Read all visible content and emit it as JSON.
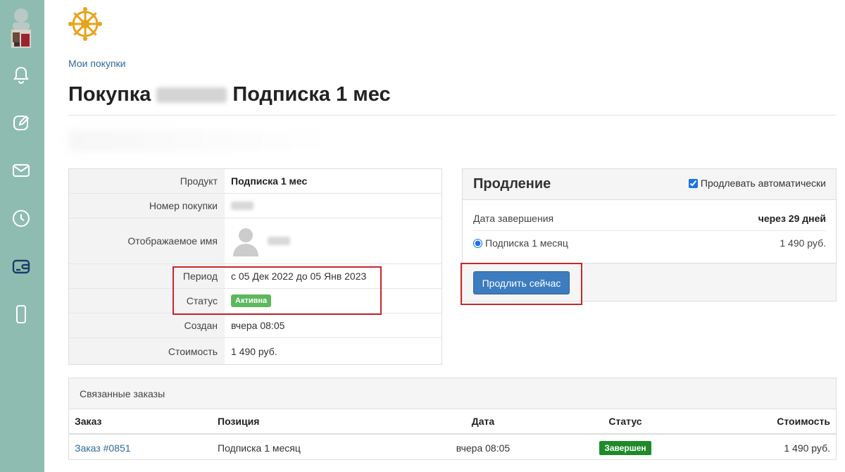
{
  "colors": {
    "sidebar": "#8fbcb1",
    "link": "#2f6a9a",
    "active_badge": "#5cb85c",
    "done_badge": "#1f8a2a",
    "primary_button": "#3c7cbf",
    "highlight": "#c8262d"
  },
  "sidebar": {
    "icons": [
      "user-avatar",
      "bell-icon",
      "edit-icon",
      "mail-icon",
      "clock-icon",
      "wallet-icon",
      "phone-icon"
    ]
  },
  "breadcrumb": "Мои покупки",
  "title": {
    "prefix": "Покупка",
    "suffix": "Подписка 1 мес"
  },
  "details": {
    "rows": [
      {
        "label": "Продукт",
        "value": "Подписка 1 мес"
      },
      {
        "label": "Номер покупки",
        "value": ""
      },
      {
        "label": "Отображаемое имя",
        "value": ""
      },
      {
        "label": "Период",
        "value": "с 05 Дек 2022 до 05 Янв 2023"
      },
      {
        "label": "Статус",
        "value": "Активна"
      },
      {
        "label": "Создан",
        "value": "вчера 08:05"
      },
      {
        "label": "Стоимость",
        "value": "1 490 руб."
      }
    ]
  },
  "renewal": {
    "title": "Продление",
    "auto_renew_label": "Продлевать автоматически",
    "auto_renew_checked": true,
    "end_date_label": "Дата завершения",
    "end_date_value": "через 29 дней",
    "plan_label": "Подписка 1 месяц",
    "plan_price": "1 490 руб.",
    "button": "Продлить сейчас"
  },
  "orders": {
    "heading": "Связанные заказы",
    "columns": [
      "Заказ",
      "Позиция",
      "Дата",
      "Статус",
      "Стоимость"
    ],
    "rows": [
      {
        "order": "Заказ #0851",
        "item": "Подписка 1 месяц",
        "date": "вчера 08:05",
        "status": "Завершен",
        "price": "1 490 руб."
      }
    ]
  }
}
